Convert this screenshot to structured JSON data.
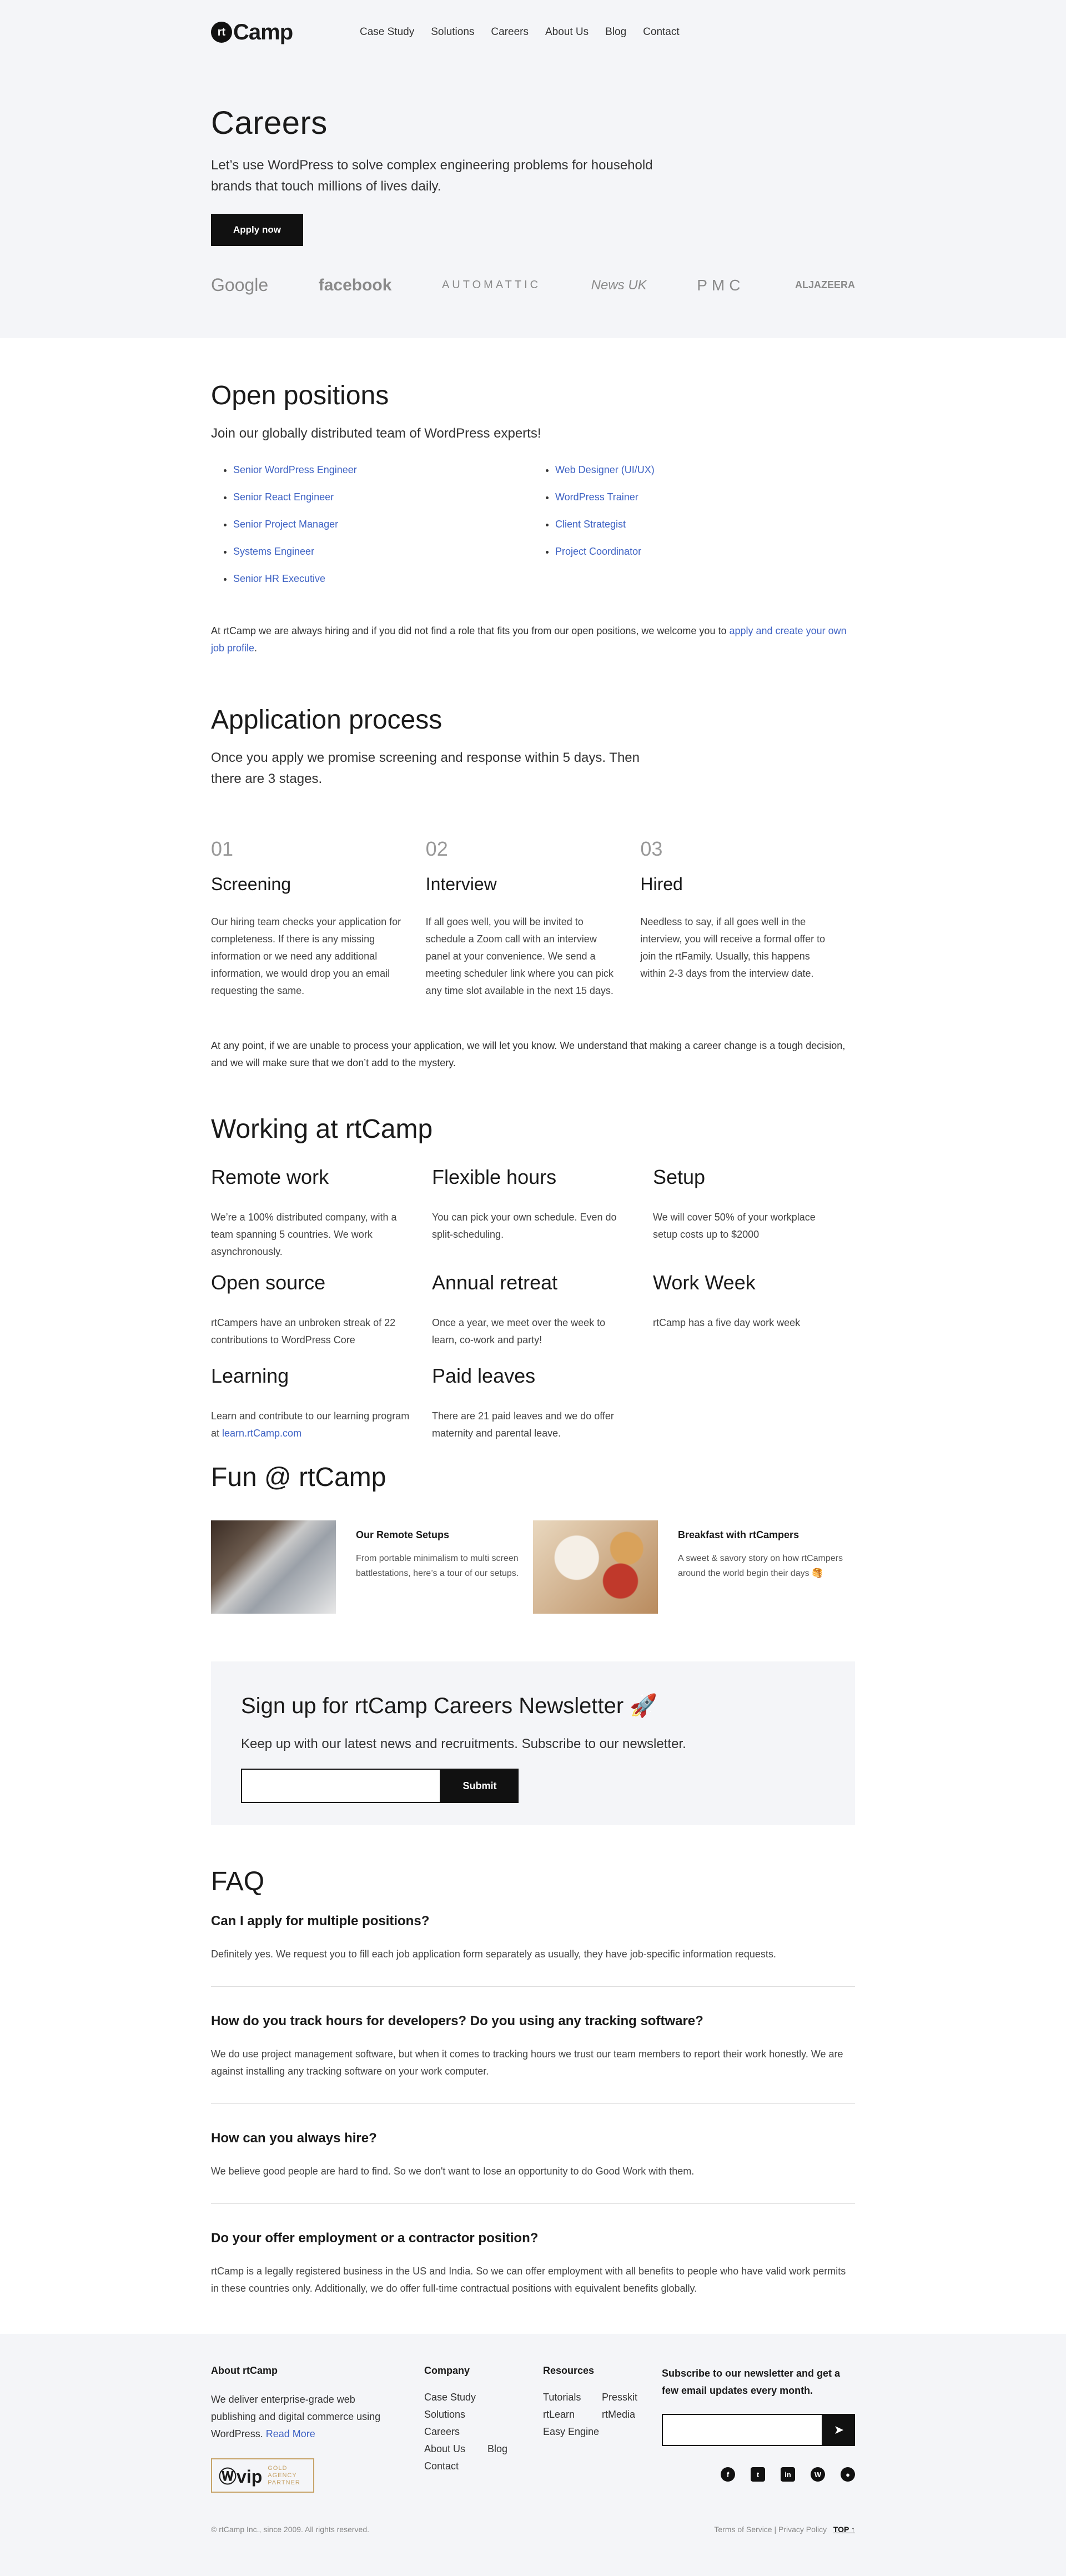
{
  "header": {
    "logo": "rtCamp",
    "nav": [
      "Case Study",
      "Solutions",
      "Careers",
      "About Us",
      "Blog",
      "Contact"
    ]
  },
  "hero": {
    "title": "Careers",
    "text": "Let’s use WordPress to solve complex engineering problems for household brands that touch millions of lives daily.",
    "cta": "Apply now",
    "brands": [
      "Google",
      "facebook",
      "AUTOMATTIC",
      "News UK",
      "PMC",
      "ALJAZEERA"
    ]
  },
  "positions": {
    "title": "Open positions",
    "lead": "Join our globally distributed team of WordPress experts!",
    "left": [
      "Senior WordPress Engineer",
      "Senior React Engineer",
      "Senior Project Manager",
      "Systems Engineer",
      "Senior HR Executive"
    ],
    "right": [
      "Web Designer (UI/UX)",
      "WordPress Trainer",
      "Client Strategist",
      "Project Coordinator"
    ],
    "note_pre": "At rtCamp we are always hiring and if you did not find a role that fits you from our open positions, we welcome you to ",
    "note_link": "apply and create your own job profile",
    "note_post": "."
  },
  "process": {
    "title": "Application process",
    "lead": "Once you apply we promise screening and response within 5 days. Then there are 3 stages.",
    "stages": [
      {
        "num": "01",
        "title": "Screening",
        "text": "Our hiring team checks your application for completeness. If there is any missing information or we need any additional information, we would drop you an email requesting the same."
      },
      {
        "num": "02",
        "title": "Interview",
        "text": "If all goes well, you will be invited to schedule a Zoom call with an interview panel at your convenience. We send a meeting scheduler link where you can pick any time slot available in the next 15 days."
      },
      {
        "num": "03",
        "title": "Hired",
        "text": "Needless to say, if all goes well in the interview, you will receive a formal offer to join the rtFamily. Usually, this happens within 2-3 days from the interview date."
      }
    ],
    "note": "At any point, if we are unable to process your application, we will let you know. We understand that making a career change is a tough decision, and we will make sure that we don’t add to the mystery."
  },
  "working": {
    "title": "Working at rtCamp",
    "perks": [
      {
        "title": "Remote work",
        "text": "We’re a 100% distributed company, with a team spanning 5 countries. We work asynchronously."
      },
      {
        "title": "Flexible hours",
        "text": "You can pick your own schedule. Even do split-scheduling."
      },
      {
        "title": "Setup",
        "text": "We will cover 50% of your workplace setup costs up to $2000"
      },
      {
        "title": "Open source",
        "text": "rtCampers have an unbroken streak of 22 contributions to WordPress Core"
      },
      {
        "title": "Annual retreat",
        "text": "Once a year, we meet over the week to learn, co-work and party!"
      },
      {
        "title": "Work Week",
        "text": "rtCamp has a five day work week"
      },
      {
        "title": "Learning",
        "text": "Learn and contribute to our learning program at "
      },
      {
        "title": "Paid leaves",
        "text": "There are 21 paid leaves and we do offer maternity and parental leave."
      }
    ],
    "learn_link": "learn.rtCamp.com"
  },
  "fun": {
    "title": "Fun @ rtCamp",
    "cards": [
      {
        "title": "Our Remote Setups",
        "text": "From portable minimalism to multi screen battlestations, here’s a tour of our setups."
      },
      {
        "title": "Breakfast with rtCampers",
        "text": "A sweet & savory story on how rtCampers around the world begin their days 🥞"
      }
    ]
  },
  "newsletter": {
    "title": "Sign up for rtCamp Careers Newsletter 🚀",
    "text": "Keep up with our latest news and recruitments. Subscribe to our newsletter.",
    "button": "Submit"
  },
  "faq": {
    "title": "FAQ",
    "items": [
      {
        "q": "Can I apply for multiple positions?",
        "a": "Definitely yes. We request you to fill each job application form separately as usually, they have job-specific information requests."
      },
      {
        "q": "How do you track hours for developers? Do you using any tracking software?",
        "a": "We do use project management software, but when it comes to tracking hours we trust our team members to report their work honestly. We are against installing any tracking software on your work computer."
      },
      {
        "q": "How can you always hire?",
        "a": "We believe good people are hard to find. So we don't want to lose an opportunity to do Good Work with them."
      },
      {
        "q": "Do your offer employment or a contractor position?",
        "a": "rtCamp is a legally registered business in the US and India. So we can offer employment with all benefits to people who have valid work permits in these countries only. Additionally, we do offer full-time contractual positions with equivalent benefits globally."
      }
    ]
  },
  "footer": {
    "about_title": "About rtCamp",
    "about_text": "We deliver enterprise-grade web publishing and digital commerce using WordPress. ",
    "read_more": "Read More",
    "badge_vip": "vip",
    "badge_text": "GOLD AGENCY PARTNER",
    "company_title": "Company",
    "company_links": [
      "Case Study",
      "Solutions",
      "Careers",
      "About Us",
      "Blog",
      "Contact"
    ],
    "resources_title": "Resources",
    "resources_links": [
      "Tutorials",
      "Presskit",
      "rtLearn",
      "rtMedia",
      "Easy Engine"
    ],
    "subscribe_text": "Subscribe to our newsletter and get a few email updates every month.",
    "copyright": "© rtCamp Inc., since 2009. All rights reserved.",
    "terms": "Terms of Service",
    "privacy": "Privacy Policy",
    "top": "TOP ↑"
  }
}
